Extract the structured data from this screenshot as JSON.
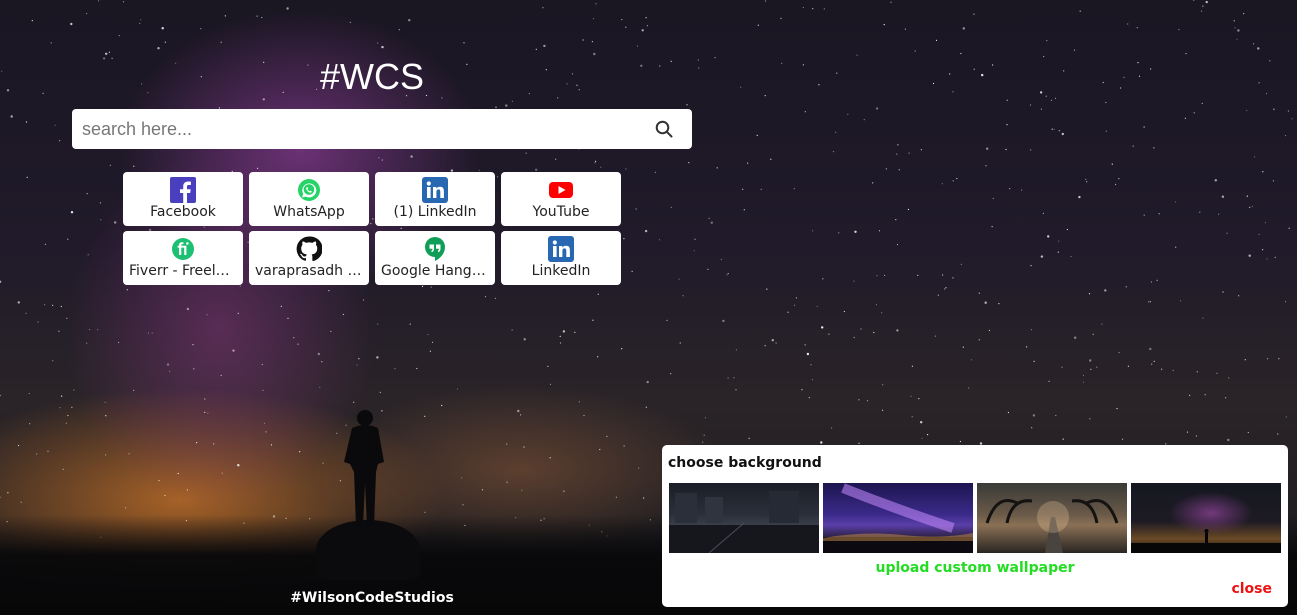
{
  "title": "#WCS",
  "search": {
    "placeholder": "search here..."
  },
  "shortcuts": [
    {
      "label": "Facebook",
      "icon": "facebook-icon",
      "color": "#4a3fbf"
    },
    {
      "label": "WhatsApp",
      "icon": "whatsapp-icon",
      "color": "#25d366"
    },
    {
      "label": "(1) LinkedIn",
      "icon": "linkedin-icon",
      "color": "#2867b2"
    },
    {
      "label": "YouTube",
      "icon": "youtube-icon",
      "color": "#ff0000"
    },
    {
      "label": "Fiverr - Freelance Services Marketplace",
      "icon": "fiverr-icon",
      "color": "#1dbf73"
    },
    {
      "label": "varaprasadh (Varaprasadh)",
      "icon": "github-icon",
      "color": "#111111"
    },
    {
      "label": "Google Hangouts",
      "icon": "hangouts-icon",
      "color": "#0f9d58"
    },
    {
      "label": "LinkedIn",
      "icon": "linkedin-icon",
      "color": "#2867b2"
    }
  ],
  "footer": {
    "brand": "#WilsonCodeStudios"
  },
  "background_panel": {
    "heading": "choose background",
    "upload_label": "upload custom wallpaper",
    "close_label": "close",
    "thumbnails": [
      "night-street-thumbnail",
      "purple-sky-thumbnail",
      "foggy-road-thumbnail",
      "milky-way-thumbnail"
    ]
  },
  "colors": {
    "upload": "#22dd22",
    "close": "#ee1111"
  }
}
